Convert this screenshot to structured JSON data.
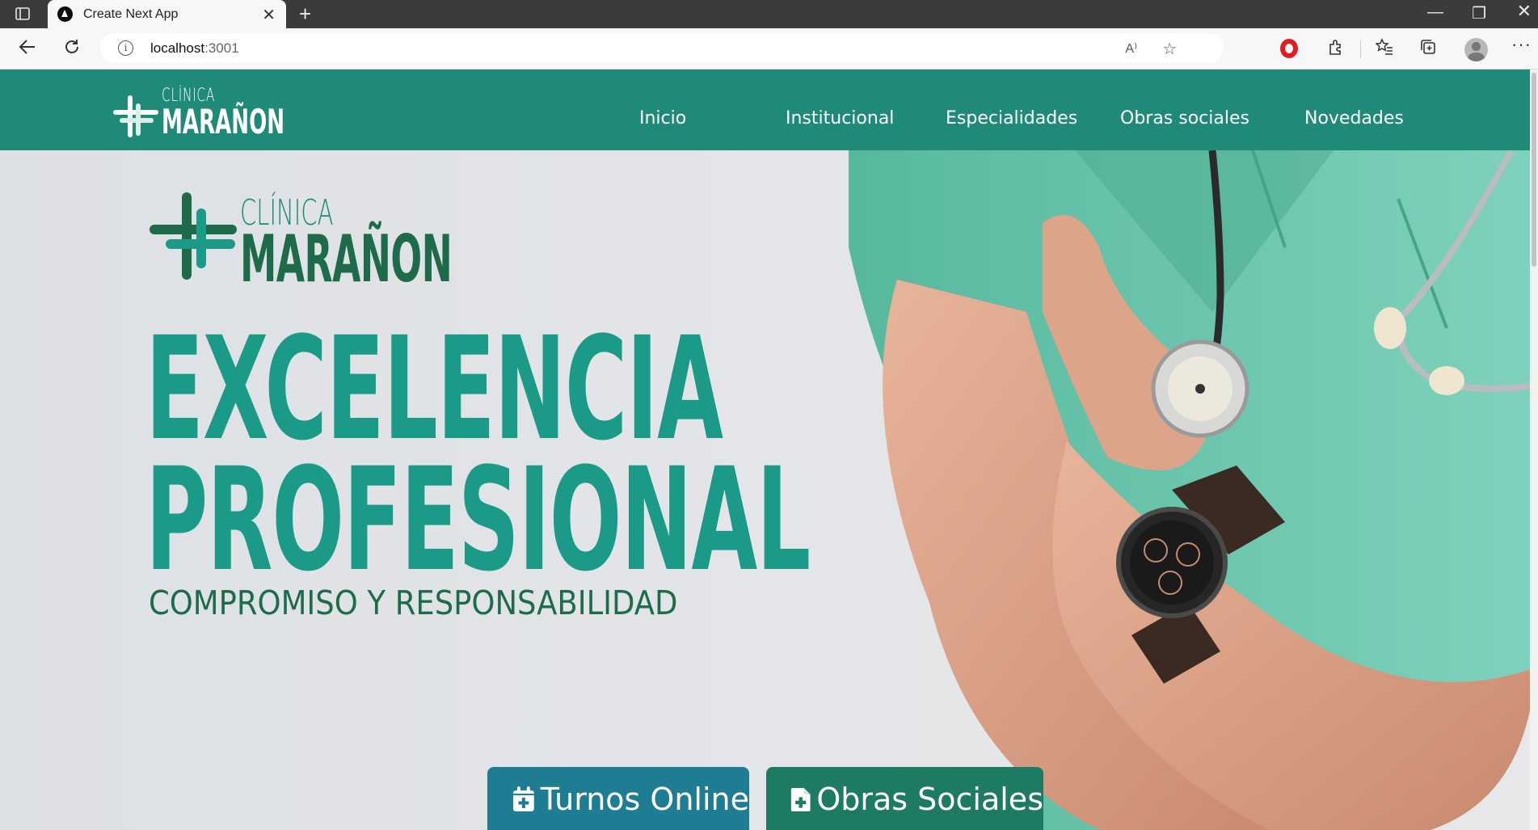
{
  "browser": {
    "tab_title": "Create Next App",
    "url_host": "localhost",
    "url_port": ":3001"
  },
  "site": {
    "logo_top": "CLÍNICA",
    "logo_bottom": "MARAÑON",
    "nav": [
      {
        "label": "Inicio"
      },
      {
        "label": "Institucional"
      },
      {
        "label": "Especialidades"
      },
      {
        "label": "Obras sociales"
      },
      {
        "label": "Novedades"
      }
    ]
  },
  "hero": {
    "logo_top": "CLÍNICA",
    "logo_bottom": "MARAÑON",
    "headline_line1": "EXCELENCIA",
    "headline_line2": "PROFESIONAL",
    "subheadline": "COMPROMISO Y RESPONSABILIDAD",
    "cta_primary": "Turnos Online",
    "cta_secondary": "Obras Sociales"
  },
  "colors": {
    "header_bg": "#1f8a78",
    "headline": "#1a9a87",
    "dark_green": "#1e6b4c",
    "cta_primary_bg": "#1e7d92",
    "cta_secondary_bg": "#1d7b63",
    "scrubs": "#62c0a5"
  }
}
